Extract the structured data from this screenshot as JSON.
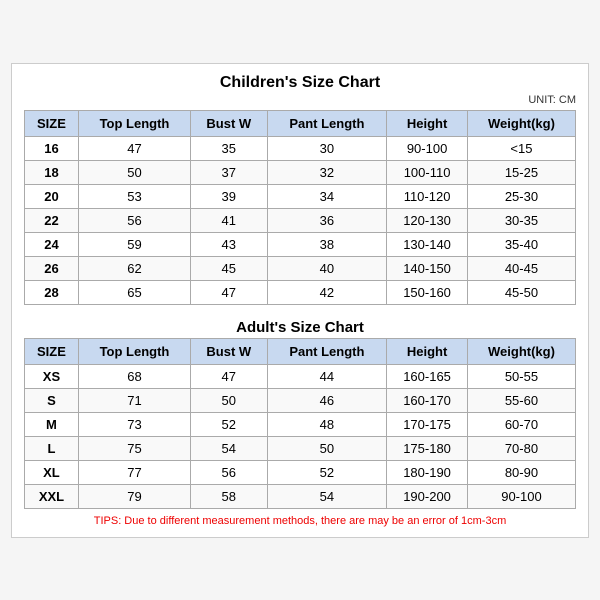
{
  "title": "Children's Size Chart",
  "unit": "UNIT: CM",
  "children": {
    "headers": [
      "SIZE",
      "Top Length",
      "Bust W",
      "Pant Length",
      "Height",
      "Weight(kg)"
    ],
    "rows": [
      [
        "16",
        "47",
        "35",
        "30",
        "90-100",
        "<15"
      ],
      [
        "18",
        "50",
        "37",
        "32",
        "100-110",
        "15-25"
      ],
      [
        "20",
        "53",
        "39",
        "34",
        "110-120",
        "25-30"
      ],
      [
        "22",
        "56",
        "41",
        "36",
        "120-130",
        "30-35"
      ],
      [
        "24",
        "59",
        "43",
        "38",
        "130-140",
        "35-40"
      ],
      [
        "26",
        "62",
        "45",
        "40",
        "140-150",
        "40-45"
      ],
      [
        "28",
        "65",
        "47",
        "42",
        "150-160",
        "45-50"
      ]
    ]
  },
  "adults": {
    "section_title": "Adult's Size Chart",
    "headers": [
      "SIZE",
      "Top Length",
      "Bust W",
      "Pant Length",
      "Height",
      "Weight(kg)"
    ],
    "rows": [
      [
        "XS",
        "68",
        "47",
        "44",
        "160-165",
        "50-55"
      ],
      [
        "S",
        "71",
        "50",
        "46",
        "160-170",
        "55-60"
      ],
      [
        "M",
        "73",
        "52",
        "48",
        "170-175",
        "60-70"
      ],
      [
        "L",
        "75",
        "54",
        "50",
        "175-180",
        "70-80"
      ],
      [
        "XL",
        "77",
        "56",
        "52",
        "180-190",
        "80-90"
      ],
      [
        "XXL",
        "79",
        "58",
        "54",
        "190-200",
        "90-100"
      ]
    ]
  },
  "tips": "TIPS: Due to different measurement methods, there are may be an error of 1cm-3cm"
}
